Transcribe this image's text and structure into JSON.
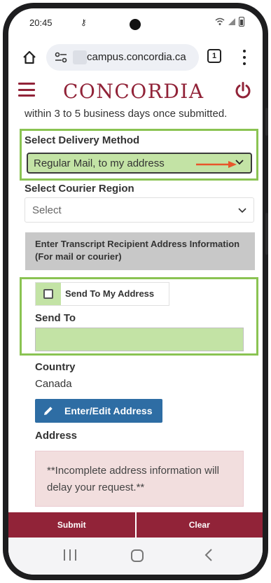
{
  "status": {
    "time": "20:45",
    "key_icon": "key-icon"
  },
  "browser": {
    "url": "campus.concordia.ca",
    "tab_count": "1"
  },
  "header": {
    "logo": "CONCORDIA",
    "accent_color": "#912338"
  },
  "form": {
    "intro_tail": "within 3 to 5 business days once submitted.",
    "delivery_label": "Select Delivery Method",
    "delivery_value": "Regular Mail, to my address",
    "courier_label": "Select Courier Region",
    "courier_placeholder": "Select",
    "recipient_banner": "Enter Transcript Recipient Address Information (For mail or courier)",
    "send_to_my_address": "Send To My Address",
    "send_to_label": "Send To",
    "country_label": "Country",
    "country_value": "Canada",
    "edit_address_button": "Enter/Edit Address",
    "address_label": "Address",
    "warning": "**Incomplete address information will delay your request.**",
    "highlight_color": "#8ac352",
    "fill_color": "#c3e3a5"
  },
  "actions": {
    "submit": "Submit",
    "clear": "Clear"
  }
}
